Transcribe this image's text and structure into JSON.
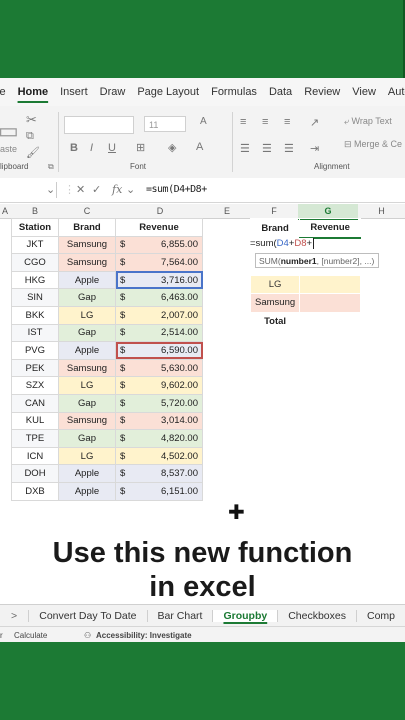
{
  "menubar": {
    "items": [
      "le",
      "Home",
      "Insert",
      "Draw",
      "Page Layout",
      "Formulas",
      "Data",
      "Review",
      "View",
      "Autc"
    ],
    "active_index": 1
  },
  "ribbon": {
    "clipboard_label": "lipboard",
    "paste_label": "aste",
    "font_label": "Font",
    "font_size": "11",
    "alignment_label": "Alignment",
    "wrap_text_label": "Wrap Text",
    "merge_label": "Merge & Ce"
  },
  "formula_bar": {
    "fx_label": "fx",
    "formula": "=sum(D4+D8+"
  },
  "columns": [
    "A",
    "B",
    "C",
    "D",
    "E",
    "F",
    "G",
    "H"
  ],
  "table": {
    "headers": [
      "Station",
      "Brand",
      "Revenue"
    ],
    "currency": "$",
    "rows": [
      {
        "station": "JKT",
        "brand": "Samsung",
        "revenue": "6,855.00"
      },
      {
        "station": "CGO",
        "brand": "Samsung",
        "revenue": "7,564.00"
      },
      {
        "station": "HKG",
        "brand": "Apple",
        "revenue": "3,716.00"
      },
      {
        "station": "SIN",
        "brand": "Gap",
        "revenue": "6,463.00"
      },
      {
        "station": "BKK",
        "brand": "LG",
        "revenue": "2,007.00"
      },
      {
        "station": "IST",
        "brand": "Gap",
        "revenue": "2,514.00"
      },
      {
        "station": "PVG",
        "brand": "Apple",
        "revenue": "6,590.00"
      },
      {
        "station": "PEK",
        "brand": "Samsung",
        "revenue": "5,630.00"
      },
      {
        "station": "SZX",
        "brand": "LG",
        "revenue": "9,602.00"
      },
      {
        "station": "CAN",
        "brand": "Gap",
        "revenue": "5,720.00"
      },
      {
        "station": "KUL",
        "brand": "Samsung",
        "revenue": "3,014.00"
      },
      {
        "station": "TPE",
        "brand": "Gap",
        "revenue": "4,820.00"
      },
      {
        "station": "ICN",
        "brand": "LG",
        "revenue": "4,502.00"
      },
      {
        "station": "DOH",
        "brand": "Apple",
        "revenue": "8,537.00"
      },
      {
        "station": "DXB",
        "brand": "Apple",
        "revenue": "6,151.00"
      }
    ]
  },
  "summary": {
    "headers": [
      "Brand",
      "Revenue"
    ],
    "rows": [
      "",
      "",
      "LG",
      "Samsung",
      "Total"
    ]
  },
  "edit_cell": {
    "prefix": "=sum(",
    "ref1": "D4",
    "plus1": "+",
    "ref2": "D8",
    "plus2": "+"
  },
  "tooltip": {
    "fn": "SUM(",
    "arg1": "number1",
    "rest": ", [number2], ...)"
  },
  "caption": {
    "line1": "Use this new function",
    "line2": "in excel"
  },
  "sheet_tabs": {
    "nav": ">",
    "tabs": [
      "Convert Day To Date",
      "Bar Chart",
      "Groupby",
      "Checkboxes",
      "Comp"
    ],
    "active_index": 2
  },
  "status_bar": {
    "left": "r",
    "calculate": "Calculate",
    "accessibility": "Accessibility: Investigate"
  },
  "colors": {
    "excel_green": "#1c7a34",
    "samsung_fill": "#fbe0d6",
    "apple_fill": "#e8eaf3",
    "gap_fill": "#e2efda",
    "lg_fill": "#fff3cc"
  }
}
